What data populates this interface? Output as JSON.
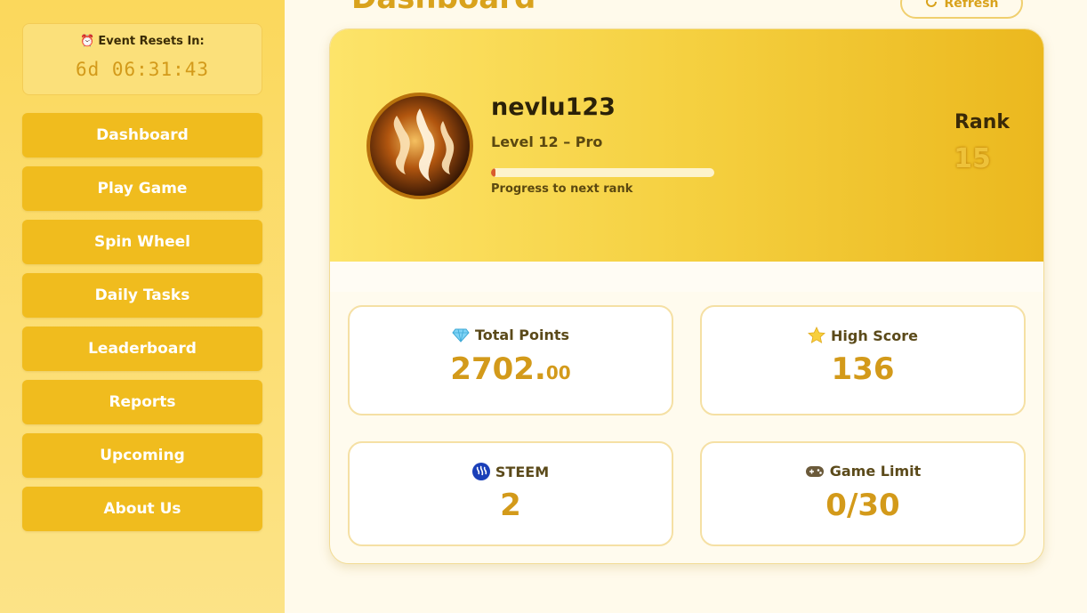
{
  "sidebar": {
    "timer": {
      "label": "Event Resets In:",
      "value": "6d 06:31:43",
      "icon": "alarm-clock-icon"
    },
    "items": [
      {
        "label": "Dashboard"
      },
      {
        "label": "Play Game"
      },
      {
        "label": "Spin Wheel"
      },
      {
        "label": "Daily Tasks"
      },
      {
        "label": "Leaderboard"
      },
      {
        "label": "Reports"
      },
      {
        "label": "Upcoming"
      },
      {
        "label": "About Us"
      }
    ]
  },
  "header": {
    "title": "Dashboard",
    "refresh_label": "Refresh"
  },
  "profile": {
    "username": "nevlu123",
    "level": "Level 12 – Pro",
    "progress_fraction": 0.02,
    "progress_label": "Progress to next rank",
    "rank_label": "Rank",
    "rank_value": "15"
  },
  "stats": {
    "total_points": {
      "label": "Total Points",
      "integer": "2702.",
      "decimals": "00",
      "icon": "gem-icon"
    },
    "high_score": {
      "label": "High Score",
      "value": "136",
      "icon": "star-icon"
    },
    "steem": {
      "label": "STEEM",
      "value": "2",
      "icon": "steem-icon"
    },
    "game_limit": {
      "label": "Game Limit",
      "value": "0/30",
      "icon": "gamepad-icon"
    }
  },
  "colors": {
    "accent": "#d39a1a",
    "nav_button": "#f0bc1e",
    "sidebar_bg": "#fbd85c",
    "progress_fill": "#d95c2b"
  }
}
